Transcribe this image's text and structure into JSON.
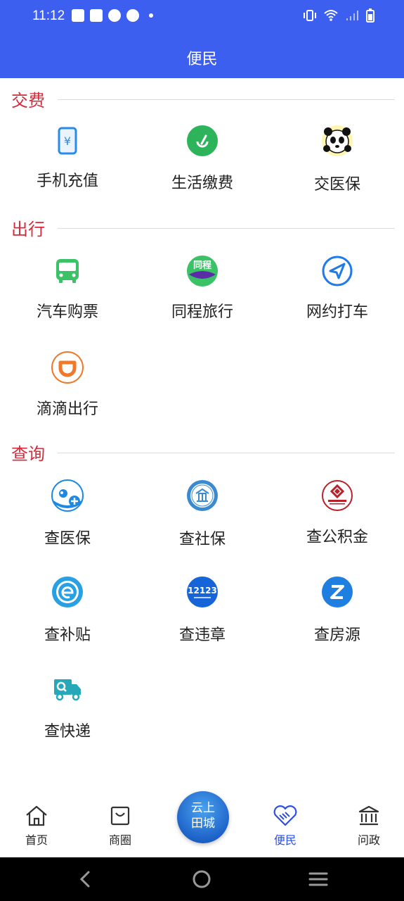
{
  "status_bar": {
    "time": "11:12"
  },
  "header": {
    "title": "便民"
  },
  "sections": [
    {
      "title": "交费",
      "items": [
        {
          "label": "手机充值",
          "icon": "phone-yuan-icon"
        },
        {
          "label": "生活缴费",
          "icon": "leaf-pay-icon"
        },
        {
          "label": "交医保",
          "icon": "panda-icon"
        }
      ]
    },
    {
      "title": "出行",
      "items": [
        {
          "label": "汽车购票",
          "icon": "bus-icon"
        },
        {
          "label": "同程旅行",
          "icon": "tongcheng-icon"
        },
        {
          "label": "网约打车",
          "icon": "navigation-icon"
        },
        {
          "label": "滴滴出行",
          "icon": "didi-icon"
        }
      ]
    },
    {
      "title": "查询",
      "items": [
        {
          "label": "查医保",
          "icon": "panda-medical-icon"
        },
        {
          "label": "查社保",
          "icon": "social-security-icon"
        },
        {
          "label": "查公积金",
          "icon": "housing-fund-icon"
        },
        {
          "label": "查补贴",
          "icon": "subsidy-icon"
        },
        {
          "label": "查违章",
          "icon": "traffic-12123-icon"
        },
        {
          "label": "查房源",
          "icon": "house-source-icon"
        },
        {
          "label": "查快递",
          "icon": "delivery-truck-icon"
        }
      ]
    }
  ],
  "icon_texts": {
    "tongcheng": "同程",
    "traffic": "12123"
  },
  "tabbar": {
    "home": "首页",
    "shop": "商圈",
    "center_line1": "云上",
    "center_line2": "田城",
    "service": "便民",
    "gov": "问政"
  },
  "colors": {
    "primary": "#3d5ff0",
    "section_title": "#d62a3a",
    "tab_active": "#2b4fe6"
  }
}
